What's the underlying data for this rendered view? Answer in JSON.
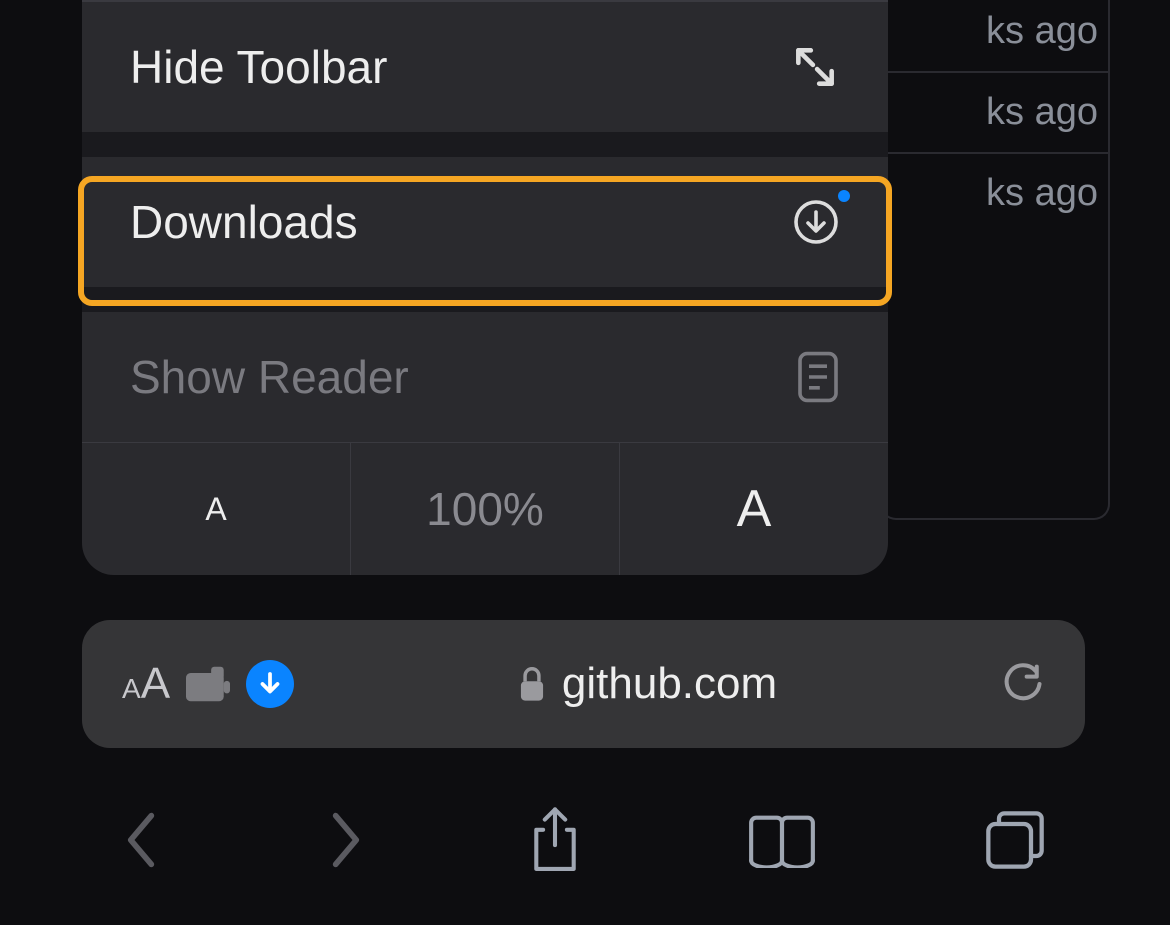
{
  "background": {
    "rows": [
      "ks ago",
      "ks ago",
      "ks ago"
    ]
  },
  "menu": {
    "hide_toolbar": "Hide Toolbar",
    "downloads": "Downloads",
    "show_reader": "Show Reader",
    "zoom_small": "A",
    "zoom_pct": "100%",
    "zoom_big": "A"
  },
  "address": {
    "domain": "github.com"
  }
}
